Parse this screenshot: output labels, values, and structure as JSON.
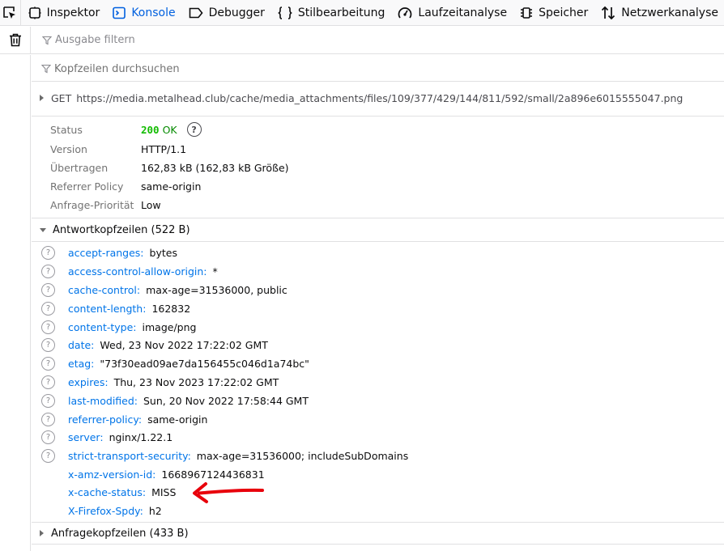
{
  "toolbar": {
    "picker_icon": "element-picker-icon",
    "tabs": [
      {
        "label": "Inspektor",
        "icon": "inspector-icon",
        "active": false
      },
      {
        "label": "Konsole",
        "icon": "console-icon",
        "active": true
      },
      {
        "label": "Debugger",
        "icon": "debugger-icon",
        "active": false
      },
      {
        "label": "Stilbearbeitung",
        "icon": "style-editor-icon",
        "active": false
      },
      {
        "label": "Laufzeitanalyse",
        "icon": "performance-icon",
        "active": false
      },
      {
        "label": "Speicher",
        "icon": "memory-icon",
        "active": false
      },
      {
        "label": "Netzwerkanalyse",
        "icon": "network-icon",
        "active": false
      }
    ]
  },
  "console": {
    "clear_icon": "trash-icon",
    "filter_placeholder": "Ausgabe filtern"
  },
  "headers_panel": {
    "search_placeholder": "Kopfzeilen durchsuchen",
    "request": {
      "method": "GET",
      "url": "https://media.metalhead.club/cache/media_attachments/files/109/377/429/144/811/592/small/2a896e6015555047.png"
    },
    "summary": [
      {
        "label": "Status",
        "value": "200",
        "status_text": "OK"
      },
      {
        "label": "Version",
        "value": "HTTP/1.1"
      },
      {
        "label": "Übertragen",
        "value": "162,83 kB (162,83 kB Größe)"
      },
      {
        "label": "Referrer Policy",
        "value": "same-origin"
      },
      {
        "label": "Anfrage-Priorität",
        "value": "Low"
      }
    ],
    "response_section": {
      "title": "Antwortkopfzeilen (522 B)",
      "headers": [
        {
          "name": "accept-ranges:",
          "value": "bytes",
          "help": true
        },
        {
          "name": "access-control-allow-origin:",
          "value": "*",
          "help": true
        },
        {
          "name": "cache-control:",
          "value": "max-age=31536000, public",
          "help": true
        },
        {
          "name": "content-length:",
          "value": "162832",
          "help": true
        },
        {
          "name": "content-type:",
          "value": "image/png",
          "help": true
        },
        {
          "name": "date:",
          "value": "Wed, 23 Nov 2022 17:22:02 GMT",
          "help": true
        },
        {
          "name": "etag:",
          "value": "\"73f30ead09ae7da156455c046d1a74bc\"",
          "help": true
        },
        {
          "name": "expires:",
          "value": "Thu, 23 Nov 2023 17:22:02 GMT",
          "help": true
        },
        {
          "name": "last-modified:",
          "value": "Sun, 20 Nov 2022 17:58:44 GMT",
          "help": true
        },
        {
          "name": "referrer-policy:",
          "value": "same-origin",
          "help": true
        },
        {
          "name": "server:",
          "value": "nginx/1.22.1",
          "help": true
        },
        {
          "name": "strict-transport-security:",
          "value": "max-age=31536000; includeSubDomains",
          "help": true
        },
        {
          "name": "x-amz-version-id:",
          "value": "1668967124436831",
          "help": false
        },
        {
          "name": "x-cache-status:",
          "value": "MISS",
          "help": false
        },
        {
          "name": "X-Firefox-Spdy:",
          "value": "h2",
          "help": false
        }
      ]
    },
    "request_section": {
      "title": "Anfragekopfzeilen (433 B)"
    }
  },
  "annotation": {
    "arrow_color": "#e8000b"
  },
  "colors": {
    "accent": "#0060df",
    "header_name": "#0074e8",
    "status_ok": "#12bc00"
  }
}
